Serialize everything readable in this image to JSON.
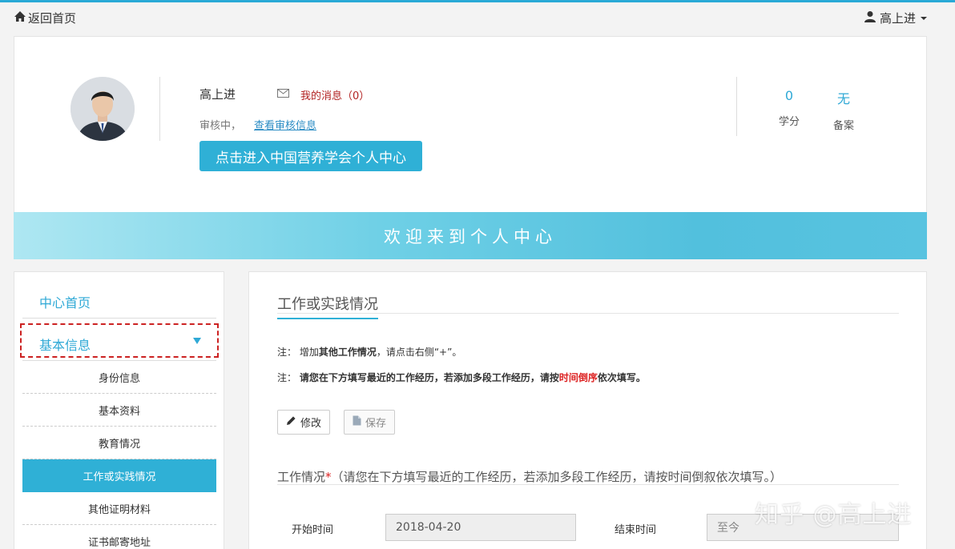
{
  "topbar": {
    "home_label": "返回首页",
    "user_name": "高上进"
  },
  "profile": {
    "name": "高上进",
    "message_label": "我的消息（0）",
    "status_text": "审核中，",
    "status_link": "查看审核信息",
    "enter_button": "点击进入中国营养学会个人中心",
    "stats": [
      {
        "value": "0",
        "label": "学分"
      },
      {
        "value": "无",
        "label": "备案"
      }
    ]
  },
  "banner": {
    "title": "欢迎来到个人中心"
  },
  "sidebar": {
    "home_label": "中心首页",
    "section_label": "基本信息",
    "items": [
      {
        "label": "身份信息"
      },
      {
        "label": "基本资料"
      },
      {
        "label": "教育情况"
      },
      {
        "label": "工作或实践情况"
      },
      {
        "label": "其他证明材料"
      },
      {
        "label": "证书邮寄地址"
      }
    ]
  },
  "main": {
    "section_title": "工作或实践情况",
    "note1": {
      "prefix": "注：  增加",
      "bold": "其他工作情况",
      "suffix": "，请点击右侧“+”。"
    },
    "note2": {
      "prefix": "注：  ",
      "bold1": "请您在下方填写最近的工作经历，若添加多段工作经历，请按",
      "red": "时间倒序",
      "bold2": "依次填写。"
    },
    "edit_button": "修改",
    "save_button": "保存",
    "work_title": "工作情况",
    "work_required": "*",
    "work_hint": "（请您在下方填写最近的工作经历，若添加多段工作经历，请按时间倒叙依次填写。）",
    "start_label": "开始时间",
    "start_value": "2018-04-20",
    "end_label": "结束时间",
    "end_placeholder": "至今"
  },
  "watermark": "知乎 @高上进"
}
